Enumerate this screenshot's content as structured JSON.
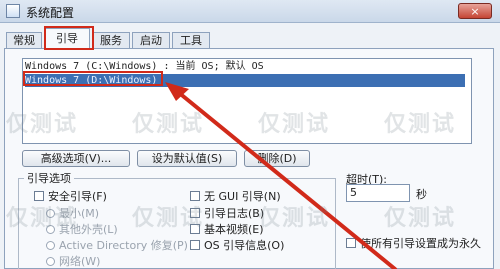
{
  "window": {
    "title": "系统配置",
    "close_label": "×"
  },
  "tabs": [
    {
      "label": "常规",
      "active": false
    },
    {
      "label": "引导",
      "active": true
    },
    {
      "label": "服务",
      "active": false
    },
    {
      "label": "启动",
      "active": false
    },
    {
      "label": "工具",
      "active": false
    }
  ],
  "os_list": [
    {
      "text": "Windows 7 (C:\\Windows) : 当前 OS; 默认 OS",
      "selected": false
    },
    {
      "text": "Windows 7 (D:\\Windows)",
      "selected": true
    }
  ],
  "buttons": {
    "advanced": "高级选项(V)...",
    "set_default": "设为默认值(S)",
    "delete": "删除(D)"
  },
  "boot_options": {
    "title": "引导选项",
    "safe_boot": "安全引导(F)",
    "minimal": "最小(M)",
    "alternate_shell": "其他外壳(L)",
    "active_directory_repair": "Active Directory 修复(P)",
    "network": "网络(W)",
    "no_gui_boot": "无 GUI 引导(N)",
    "boot_log": "引导日志(B)",
    "base_video": "基本视频(E)",
    "os_boot_info": "OS 引导信息(O)"
  },
  "timeout": {
    "label": "超时(T):",
    "value": "5",
    "unit": "秒"
  },
  "make_permanent": "使所有引导设置成为永久",
  "watermark": "仅测试",
  "colors": {
    "highlight_red": "#d12a1a",
    "selection_blue": "#3c6fb3"
  }
}
